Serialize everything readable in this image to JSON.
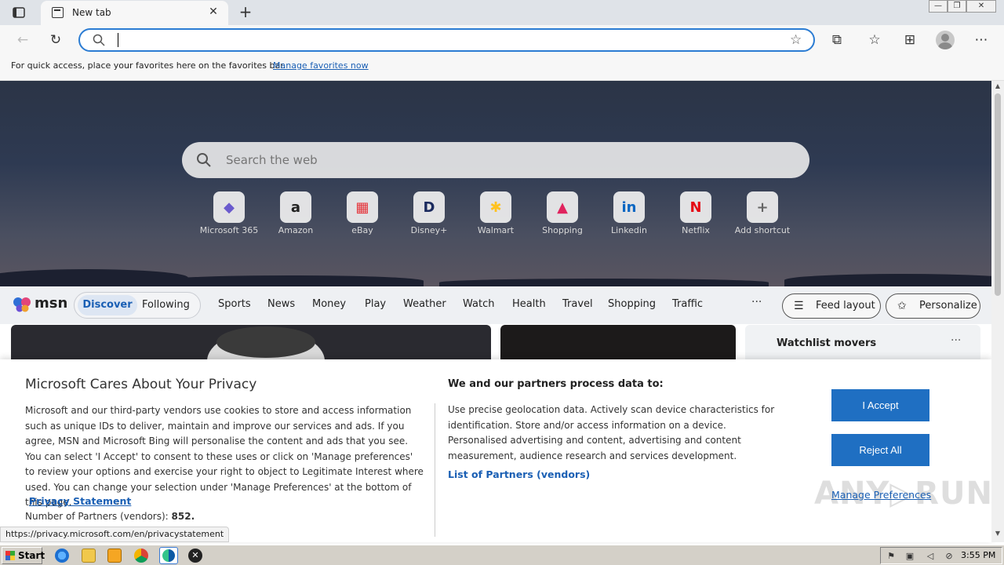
{
  "browser": {
    "tab_title": "New tab",
    "tab_close": "✕",
    "new_tab": "+",
    "win_min": "—",
    "win_max": "❐",
    "win_close": "✕"
  },
  "toolbar": {
    "address_value": "",
    "back": "←",
    "reload": "↻",
    "fav_add": "☆",
    "extensions": "⧉",
    "favorites": "☆",
    "collections": "⊞",
    "more": "⋯"
  },
  "favbar": {
    "text": "For quick access, place your favorites here on the favorites bar.",
    "link": "Manage favorites now"
  },
  "hero": {
    "search_placeholder": "Search the web",
    "shortcuts": [
      {
        "label": "Microsoft 365",
        "glyph": "◆",
        "color": "#6a5acd"
      },
      {
        "label": "Amazon",
        "glyph": "a",
        "color": "#222222"
      },
      {
        "label": "eBay",
        "glyph": "▦",
        "color": "#e53238"
      },
      {
        "label": "Disney+",
        "glyph": "D",
        "color": "#1b2a5e"
      },
      {
        "label": "Walmart",
        "glyph": "✱",
        "color": "#ffc220"
      },
      {
        "label": "Shopping",
        "glyph": "▲",
        "color": "#e0245e"
      },
      {
        "label": "Linkedin",
        "glyph": "in",
        "color": "#0a66c2"
      },
      {
        "label": "Netflix",
        "glyph": "N",
        "color": "#e50914"
      },
      {
        "label": "Add shortcut",
        "glyph": "+",
        "color": "#666666"
      }
    ]
  },
  "msn": {
    "logo": "msn",
    "tabs": {
      "discover": "Discover",
      "following": "Following"
    },
    "links": [
      "Sports",
      "News",
      "Money",
      "Play",
      "Weather",
      "Watch",
      "Health",
      "Travel",
      "Shopping",
      "Traffic"
    ],
    "more": "···",
    "feed_layout": "Feed layout",
    "personalize": "Personalize",
    "watchlist_title": "Watchlist movers",
    "watchlist_more": "···"
  },
  "privacy": {
    "title": "Microsoft Cares About Your Privacy",
    "body": "Microsoft and our third-party vendors use cookies to store and access information such as unique IDs to deliver, maintain and improve our services and ads. If you agree, MSN and Microsoft Bing will personalise the content and ads that you see. You can select 'I Accept' to consent to these uses or click on 'Manage preferences' to review your options and exercise your right to object to Legitimate Interest where used.  You can change your selection under 'Manage Preferences' at the bottom of this page.",
    "statement_link": "Privacy Statement",
    "statement_dot": ".",
    "partners_label": "Number of Partners (vendors):",
    "partners_count": "852.",
    "process_title": "We and our partners process data to:",
    "process_body": "Use precise geolocation data. Actively scan device characteristics for identification. Store and/or access information on a device. Personalised advertising and content, advertising and content measurement, audience research and services development.",
    "partners_link": "List of Partners (vendors)",
    "accept": "I Accept",
    "reject": "Reject All",
    "manage": "Manage Preferences",
    "watermark": "ANY▷RUN"
  },
  "status_url": "https://privacy.microsoft.com/en/privacystatement",
  "taskbar": {
    "start": "Start",
    "clock": "3:55 PM"
  },
  "colors": {
    "accent": "#1f6fc2",
    "link": "#1a5fb4"
  }
}
